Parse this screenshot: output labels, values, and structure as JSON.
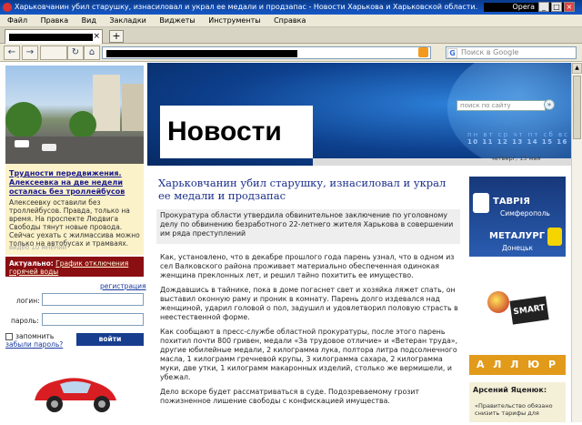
{
  "window": {
    "title": "Харьковчанин убил старушку, изнасиловал и украл ее медали и продзапас - Новости Харькова и Харьковской области.",
    "app_name": "Opera",
    "controls": [
      "_",
      "□",
      "×"
    ]
  },
  "menu": [
    "Файл",
    "Правка",
    "Вид",
    "Закладки",
    "Виджеты",
    "Инструменты",
    "Справка"
  ],
  "tabs": {
    "close": "×",
    "new_tab": "+"
  },
  "nav": {
    "back": "←",
    "forward": "→",
    "reload": "↻",
    "home": "⌂",
    "rss": "RSS",
    "search_placeholder": "Поиск в Google",
    "search_engine": "G"
  },
  "header": {
    "logo_text": "Новости",
    "site_search_placeholder": "поиск по сайту",
    "site_search_go": "»",
    "weekdays": "пн вт ср чт пт сб вс",
    "dates": "10 11 12 13 14 15 16",
    "date_text": "четверг, 13 мая"
  },
  "left": {
    "headline": "Трудности передвижения. Алексеевка на две недели осталась без троллейбусов",
    "text": "Алексеевку оставили без троллейбусов. Правда, только на время. На проспекте Людвига Свободы тянут новые провода. Сейчас уехать с жилмассива можно только на автобусах и трамваях.",
    "meta": "видео   10 мнений",
    "actual_label": "Актуально:",
    "actual_link": "График отключения горячей воды",
    "register": "регистрация",
    "login_label": "логин:",
    "password_label": "пароль:",
    "remember": "запомнить",
    "forgot": "забыли пароль?",
    "login_button": "войти"
  },
  "article": {
    "title": "Харьковчанин убил старушку, изнасиловал и украл ее медали и продзапас",
    "lead": "Прокуратура области утвердила обвинительное заключение по уголовному делу по обвинению безработного 22-летнего жителя Харькова в совершении им ряда преступлений",
    "paragraphs": [
      "Как, установлено, что в декабре прошлого года парень узнал, что в одном из сел Валковского района проживает материально обеспеченная одинокая женщина преклонных лет, и решил тайно похитить ее имущество.",
      "Дождавшись в тайнике, пока в доме погаснет свет и хозяйка ляжет спать, он выставил оконную раму и проник в комнату. Парень долго издевался над женщиной, ударил головой о пол, задушил и удовлетворил половую страсть в неестественной форме.",
      "Как сообщают в пресс-службе областной прокуратуры, после этого парень похитил почти 800 гривен, медали «За трудовое отличие» и «Ветеран труда», другие юбилейные медали, 2 килограмма лука, полтора литра подсолнечного масла, 1 килограмм гречневой крупы, 3 килограмма сахара, 2 килограмма муки, две утки, 1 килограмм макаронных изделий, столько же вермишели, и убежал.",
      "Дело вскоре будет рассматриваться в суде. Подозреваемому грозит пожизненное лишение свободы с конфискацией имущества."
    ]
  },
  "ads": {
    "tavria": "ТАВРІЯ",
    "simferopol": "Симферополь",
    "metalurg": "МЕТАЛУРГ",
    "donetsk": "Донецьк",
    "smart": "SMART",
    "allyur": "А Л Л Ю Р",
    "yatsenyuk_name": "Арсений Яценюк:",
    "yatsenyuk_quote": "«Правительство обязано снизить тарифы для"
  },
  "colors": {
    "header_blue": "#0d3f8c",
    "title_blue": "#1b2f8a",
    "actual_red": "#8b0e12",
    "login_blue": "#173d8f"
  }
}
